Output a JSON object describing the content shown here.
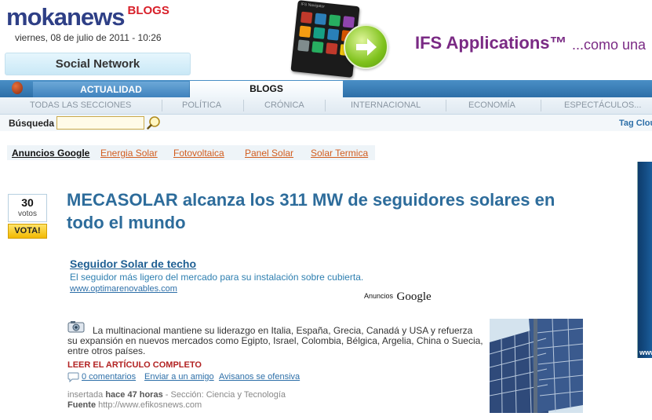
{
  "header": {
    "logo_main": "mokanews",
    "logo_blogs": "BLOGS",
    "date": "viernes, 08 de julio de 2011 - 10:26",
    "social_network": "Social Network"
  },
  "banner_ad": {
    "title": "IFS Applications™",
    "tagline": "...como una",
    "device_title": "IFS Navigator"
  },
  "nav": {
    "tabs": [
      {
        "label": "ACTUALIDAD"
      },
      {
        "label": "BLOGS"
      }
    ],
    "sections": [
      {
        "label": "TODAS LAS SECCIONES"
      },
      {
        "label": "POLÍTICA"
      },
      {
        "label": "CRÓNICA"
      },
      {
        "label": "INTERNACIONAL"
      },
      {
        "label": "ECONOMÍA"
      },
      {
        "label": "ESPECTÁCULOS..."
      }
    ]
  },
  "search": {
    "label": "Búsqueda",
    "value": "",
    "tag_cloud": "Tag Clou"
  },
  "google_links": {
    "title": "Anuncios Google",
    "links": [
      {
        "label": "Energia Solar"
      },
      {
        "label": "Fotovoltaica"
      },
      {
        "label": "Panel Solar"
      },
      {
        "label": "Solar Termica"
      }
    ]
  },
  "vote": {
    "count": "30",
    "label": "votos",
    "button": "VOTA!"
  },
  "article": {
    "headline": "MECASOLAR alcanza los 311 MW de seguidores solares en todo el mundo",
    "ad": {
      "title": "Seguidor Solar de techo",
      "description": "El seguidor más ligero del mercado para su instalación sobre cubierta.",
      "url": "www.optimarenovables.com",
      "label_small": "Anuncios",
      "label_big": "Google"
    },
    "body": "La multinacional mantiene su liderazgo en Italia, España, Grecia, Canadá y USA y refuerza su expansión en nuevos mercados como Egipto, Israel, Colombia, Bélgica, Argelia, China o Suecia, entre otros países.",
    "read_more": "LEER EL ARTÍCULO COMPLETO",
    "actions": {
      "comments": "0 comentarios",
      "send": "Enviar a un amigo",
      "report": "Avisanos se ofensiva"
    },
    "meta": {
      "inserted_label": "insertada",
      "inserted_time": "hace 47 horas",
      "section": "- Sección: Ciencia y Tecnología",
      "source_label": "Fuente",
      "source_url": "http://www.efikosnews.com"
    }
  },
  "side_ad": {
    "text": "www"
  },
  "colors": {
    "brand_blue": "#2e3f86",
    "brand_red": "#d8202a",
    "headline": "#2d6c9b",
    "link_orange": "#d25c1e",
    "read_more": "#b22222",
    "ad_purple": "#7a2a84"
  }
}
